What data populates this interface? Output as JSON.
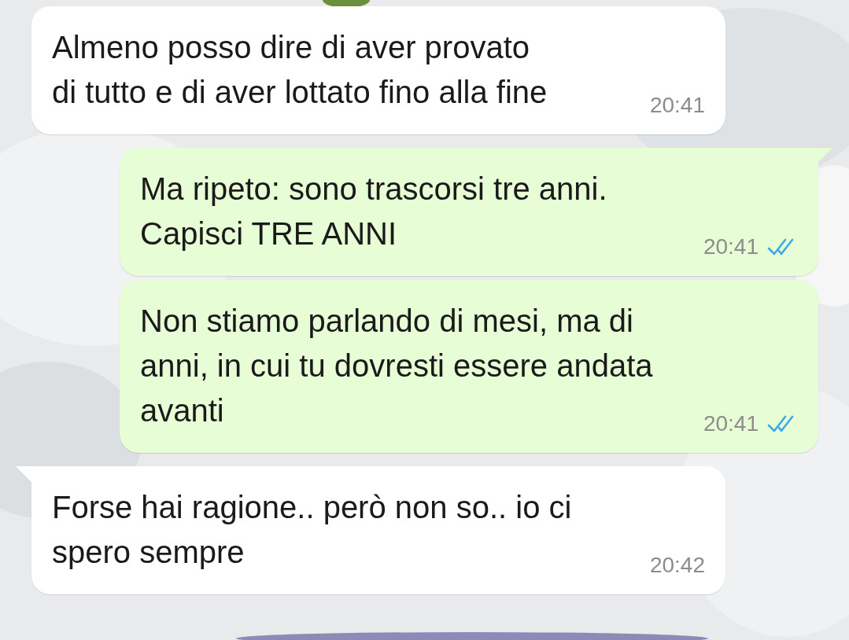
{
  "messages": [
    {
      "kind": "incoming",
      "tail": false,
      "text": "Almeno posso dire di aver provato\ndi tutto e di aver lottato fino alla fine",
      "time": "20:41"
    },
    {
      "kind": "outgoing",
      "tail": true,
      "text": "Ma ripeto: sono trascorsi tre anni.\nCapisci TRE ANNI",
      "time": "20:41",
      "read": true
    },
    {
      "kind": "outgoing",
      "tail": false,
      "text": "Non stiamo parlando di mesi, ma di\nanni, in cui tu dovresti essere andata\navanti",
      "time": "20:41",
      "read": true
    },
    {
      "kind": "incoming",
      "tail": true,
      "text": "Forse hai ragione.. però non so.. io ci\nspero sempre",
      "time": "20:42"
    }
  ]
}
